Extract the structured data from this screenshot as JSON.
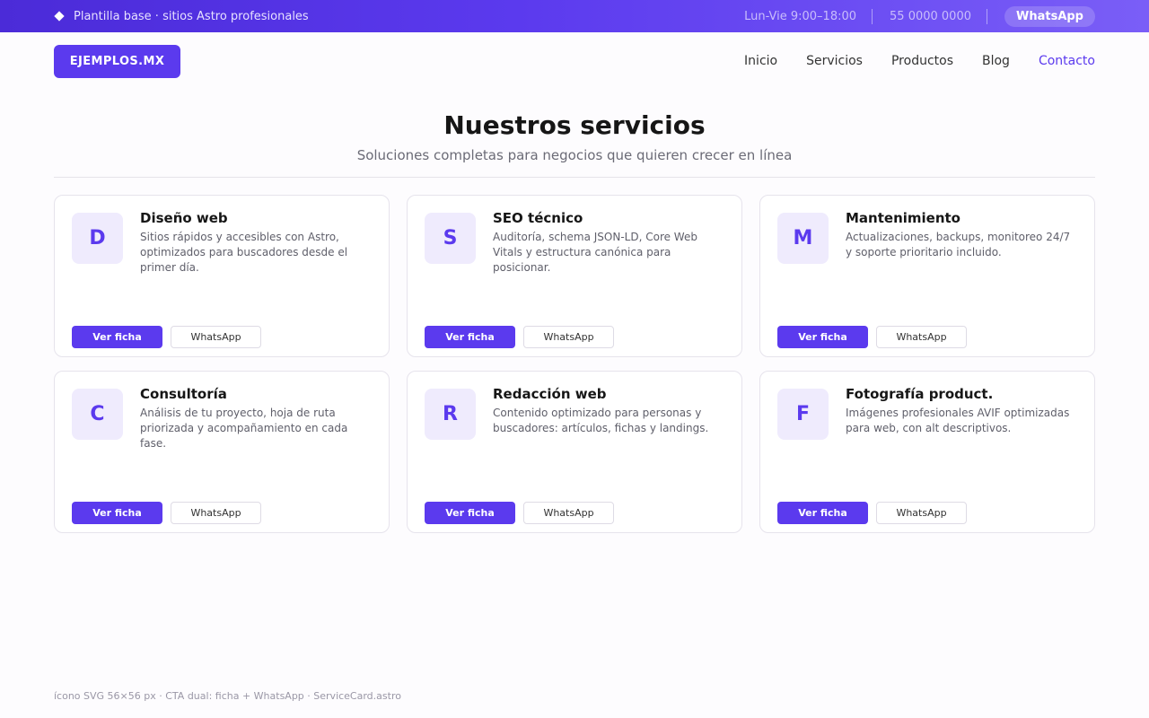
{
  "topbar": {
    "tagline": "Plantilla base · sitios Astro profesionales",
    "hours": "Lun-Vie  9:00–18:00",
    "phone": "55 0000 0000",
    "whatsapp": "WhatsApp"
  },
  "nav": {
    "logo": "EJEMPLOS.MX",
    "links": [
      "Inicio",
      "Servicios",
      "Productos",
      "Blog",
      "Contacto"
    ],
    "active": "Contacto"
  },
  "hero": {
    "title": "Nuestros servicios",
    "subtitle": "Soluciones completas para negocios que quieren crecer en línea"
  },
  "cards": [
    {
      "letter": "D",
      "title": "Diseño web",
      "desc": "Sitios rápidos y accesibles con Astro, optimizados para buscadores desde el primer día.",
      "primary": "Ver ficha",
      "secondary": "WhatsApp"
    },
    {
      "letter": "S",
      "title": "SEO técnico",
      "desc": "Auditoría, schema JSON-LD, Core Web Vitals y estructura canónica para posicionar.",
      "primary": "Ver ficha",
      "secondary": "WhatsApp"
    },
    {
      "letter": "M",
      "title": "Mantenimiento",
      "desc": "Actualizaciones, backups, monitoreo 24/7 y soporte prioritario incluido.",
      "primary": "Ver ficha",
      "secondary": "WhatsApp"
    },
    {
      "letter": "C",
      "title": "Consultoría",
      "desc": "Análisis de tu proyecto, hoja de ruta priorizada y acompañamiento en cada fase.",
      "primary": "Ver ficha",
      "secondary": "WhatsApp"
    },
    {
      "letter": "R",
      "title": "Redacción web",
      "desc": "Contenido optimizado para personas y buscadores: artículos, fichas y landings.",
      "primary": "Ver ficha",
      "secondary": "WhatsApp"
    },
    {
      "letter": "F",
      "title": "Fotografía product.",
      "desc": "Imágenes profesionales AVIF optimizadas para web, con alt descriptivos.",
      "primary": "Ver ficha",
      "secondary": "WhatsApp"
    }
  ],
  "footer": {
    "note": "ícono SVG 56×56 px  ·  CTA dual: ficha + WhatsApp  ·  ServiceCard.astro"
  },
  "colors": {
    "accent": "#5b3aee",
    "icon_bg": "#efebfd"
  }
}
